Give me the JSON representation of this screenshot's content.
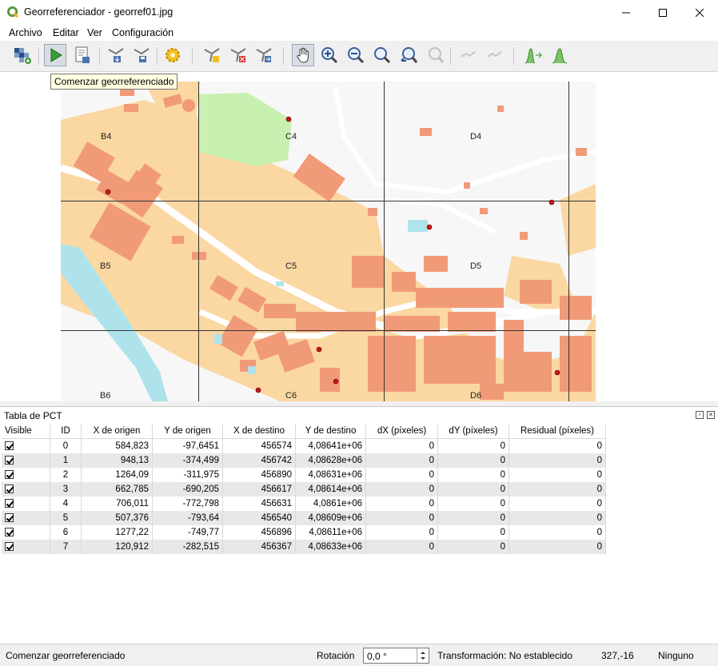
{
  "window": {
    "title": "Georreferenciador - georref01.jpg"
  },
  "menu": [
    "Archivo",
    "Editar",
    "Ver",
    "Configuración"
  ],
  "toolbar": {
    "tooltip": "Comenzar georreferenciado"
  },
  "map": {
    "grid_labels": [
      {
        "text": "B4"
      },
      {
        "text": "C4"
      },
      {
        "text": "D4"
      },
      {
        "text": "B5"
      },
      {
        "text": "C5"
      },
      {
        "text": "D5"
      },
      {
        "text": "B6"
      },
      {
        "text": "C6"
      },
      {
        "text": "D6"
      }
    ],
    "colors": {
      "block": "#fbd7a2",
      "building": "#f19a78",
      "park": "#c8f0b0",
      "water": "#aee3ec",
      "road": "#ffffff",
      "gcp": "#c8181c"
    }
  },
  "gcp_panel": {
    "title": "Tabla de PCT",
    "columns": [
      "Visible",
      "ID",
      "X de origen",
      "Y de origen",
      "X de destino",
      "Y de destino",
      "dX (píxeles)",
      "dY (píxeles)",
      "Residual (píxeles)"
    ],
    "rows": [
      {
        "id": "0",
        "x_src": "584,823",
        "y_src": "-97,6451",
        "x_dst": "456574",
        "y_dst": "4,08641e+06",
        "dx": "0",
        "dy": "0",
        "res": "0"
      },
      {
        "id": "1",
        "x_src": "948,13",
        "y_src": "-374,499",
        "x_dst": "456742",
        "y_dst": "4,08628e+06",
        "dx": "0",
        "dy": "0",
        "res": "0"
      },
      {
        "id": "2",
        "x_src": "1264,09",
        "y_src": "-311,975",
        "x_dst": "456890",
        "y_dst": "4,08631e+06",
        "dx": "0",
        "dy": "0",
        "res": "0"
      },
      {
        "id": "3",
        "x_src": "662,785",
        "y_src": "-690,205",
        "x_dst": "456617",
        "y_dst": "4,08614e+06",
        "dx": "0",
        "dy": "0",
        "res": "0"
      },
      {
        "id": "4",
        "x_src": "706,011",
        "y_src": "-772,798",
        "x_dst": "456631",
        "y_dst": "4,0861e+06",
        "dx": "0",
        "dy": "0",
        "res": "0"
      },
      {
        "id": "5",
        "x_src": "507,376",
        "y_src": "-793,64",
        "x_dst": "456540",
        "y_dst": "4,08609e+06",
        "dx": "0",
        "dy": "0",
        "res": "0"
      },
      {
        "id": "6",
        "x_src": "1277,22",
        "y_src": "-749,77",
        "x_dst": "456896",
        "y_dst": "4,08611e+06",
        "dx": "0",
        "dy": "0",
        "res": "0"
      },
      {
        "id": "7",
        "x_src": "120,912",
        "y_src": "-282,515",
        "x_dst": "456367",
        "y_dst": "4,08633e+06",
        "dx": "0",
        "dy": "0",
        "res": "0"
      }
    ]
  },
  "status": {
    "message": "Comenzar georreferenciado",
    "rotation_label": "Rotación",
    "rotation_value": "0,0 °",
    "transform": "Transformación: No establecido",
    "coords": "327,-16",
    "crs": "Ninguno"
  }
}
